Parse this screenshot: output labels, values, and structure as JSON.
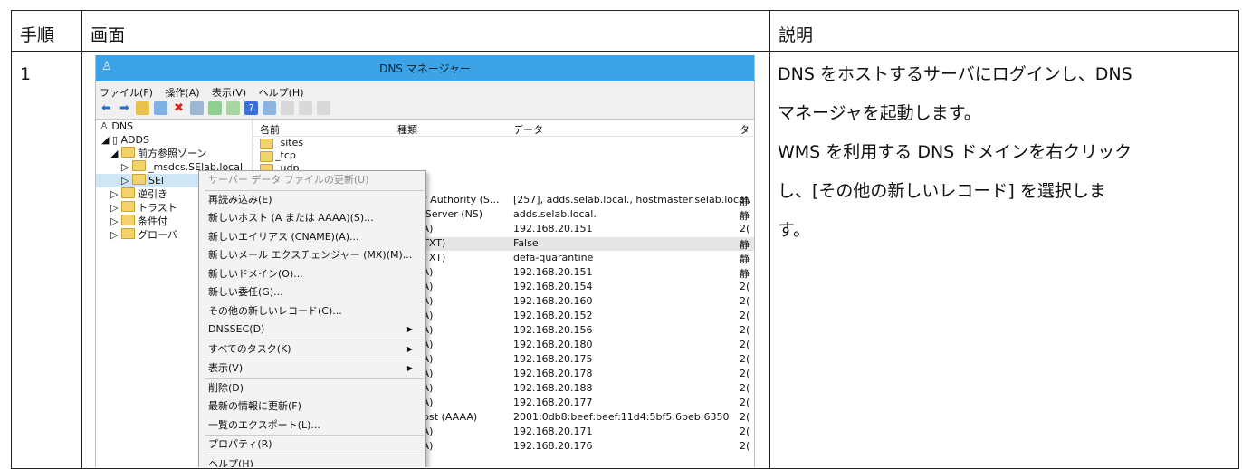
{
  "table": {
    "headers": [
      "手順",
      "画面",
      "説明"
    ],
    "step": "1",
    "description": [
      "DNS をホストするサーバにログインし、DNS",
      "マネージャを起動します。",
      "WMS を利用する DNS ドメインを右クリック",
      "し、[その他の新しいレコード] を選択しま",
      "す。"
    ]
  },
  "dns_window": {
    "title": "DNS マネージャー",
    "menubar": [
      "ファイル(F)",
      "操作(A)",
      "表示(V)",
      "ヘルプ(H)"
    ],
    "toolbar_icons": [
      "back-arrow-icon",
      "forward-arrow-icon",
      "up-folder-icon",
      "console-tree-icon",
      "delete-icon",
      "properties-icon",
      "refresh-icon",
      "export-icon",
      "help-icon",
      "view-icon",
      "server-icon",
      "list-icon",
      "details-icon"
    ],
    "tree": [
      "DNS",
      "ADDS",
      "前方参照ゾーン",
      "_msdcs.SElab.local",
      "SEl",
      "逆引き",
      "トラスト",
      "条件付",
      "グローバ"
    ],
    "columns": [
      "名前",
      "種類",
      "データ",
      "タ"
    ],
    "folders": [
      "_sites",
      "_tcp",
      "_udp"
    ],
    "records": [
      {
        "type": "art of Authority (S...",
        "data": "[257], adds.selab.local., hostmaster.selab.local.",
        "ts": "静"
      },
      {
        "type": "ame Server (NS)",
        "data": "adds.selab.local.",
        "ts": "静"
      },
      {
        "type": "ost (A)",
        "data": "192.168.20.151",
        "ts": "2("
      },
      {
        "type": "ext (TXT)",
        "data": "False",
        "ts": "静"
      },
      {
        "type": "ext (TXT)",
        "data": "defa-quarantine",
        "ts": "静"
      },
      {
        "type": "ost (A)",
        "data": "192.168.20.151",
        "ts": "静"
      },
      {
        "type": "ost (A)",
        "data": "192.168.20.154",
        "ts": "2("
      },
      {
        "type": "ost (A)",
        "data": "192.168.20.160",
        "ts": "2("
      },
      {
        "type": "ost (A)",
        "data": "192.168.20.152",
        "ts": "2("
      },
      {
        "type": "ost (A)",
        "data": "192.168.20.156",
        "ts": "2("
      },
      {
        "type": "ost (A)",
        "data": "192.168.20.180",
        "ts": "2("
      },
      {
        "type": "ost (A)",
        "data": "192.168.20.175",
        "ts": "2("
      },
      {
        "type": "ost (A)",
        "data": "192.168.20.178",
        "ts": "2("
      },
      {
        "type": "ost (A)",
        "data": "192.168.20.188",
        "ts": "2("
      },
      {
        "type": "ost (A)",
        "data": "192.168.20.177",
        "ts": "2("
      },
      {
        "type": "v6 Host (AAAA)",
        "data": "2001:0db8:beef:beef:11d4:5bf5:6beb:6350",
        "ts": "2("
      },
      {
        "type": "ost (A)",
        "data": "192.168.20.171",
        "ts": "2("
      },
      {
        "type": "ost (A)",
        "data": "192.168.20.176",
        "ts": "2("
      }
    ],
    "context_menu": [
      "サーバー データ ファイルの更新(U)",
      "再読み込み(E)",
      "新しいホスト (A または AAAA)(S)...",
      "新しいエイリアス (CNAME)(A)...",
      "新しいメール エクスチェンジャー (MX)(M)...",
      "新しいドメイン(O)...",
      "新しい委任(G)...",
      "その他の新しいレコード(C)...",
      "DNSSEC(D)",
      "すべてのタスク(K)",
      "表示(V)",
      "削除(D)",
      "最新の情報に更新(F)",
      "一覧のエクスポート(L)...",
      "プロパティ(R)",
      "ヘルプ(H)"
    ]
  },
  "colors": {
    "titlebar": "#3ba3e6",
    "menu_bg": "#f3f3f3",
    "folder": "#f2d36b"
  }
}
